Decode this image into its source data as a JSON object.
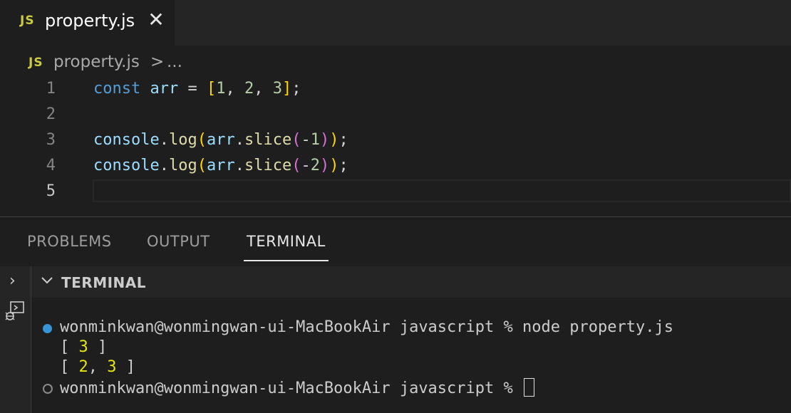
{
  "tab": {
    "badge": "JS",
    "title": "property.js",
    "close_icon": "close-icon"
  },
  "breadcrumb": {
    "badge": "JS",
    "file": "property.js",
    "separator": ">",
    "more": "..."
  },
  "editor": {
    "lines": [
      {
        "number": "1",
        "code": "const arr = [1, 2, 3];"
      },
      {
        "number": "2",
        "code": ""
      },
      {
        "number": "3",
        "code": "console.log(arr.slice(-1));"
      },
      {
        "number": "4",
        "code": "console.log(arr.slice(-2));"
      },
      {
        "number": "5",
        "code": ""
      }
    ],
    "active_line": "5"
  },
  "panel": {
    "tabs": [
      {
        "label": "PROBLEMS"
      },
      {
        "label": "OUTPUT"
      },
      {
        "label": "TERMINAL"
      }
    ],
    "active_tab": "TERMINAL"
  },
  "terminal": {
    "section_title": "TERMINAL",
    "lines": [
      {
        "prompt": "wonminkwan@wonmingwan-ui-MacBookAir javascript % node property.js",
        "status": "success"
      },
      {
        "output": "[ 3 ]"
      },
      {
        "output": "[ 2, 3 ]"
      },
      {
        "prompt": "wonminkwan@wonmingwan-ui-MacBookAir javascript % ",
        "status": "idle"
      }
    ]
  },
  "colors": {
    "js_badge": "#cbcb41",
    "keyword": "#569cd6",
    "variable": "#9cdcfe",
    "function": "#dcdcaa",
    "number": "#b5cea8",
    "terminal_number": "#e5e510",
    "success_dot": "#3794d6"
  }
}
